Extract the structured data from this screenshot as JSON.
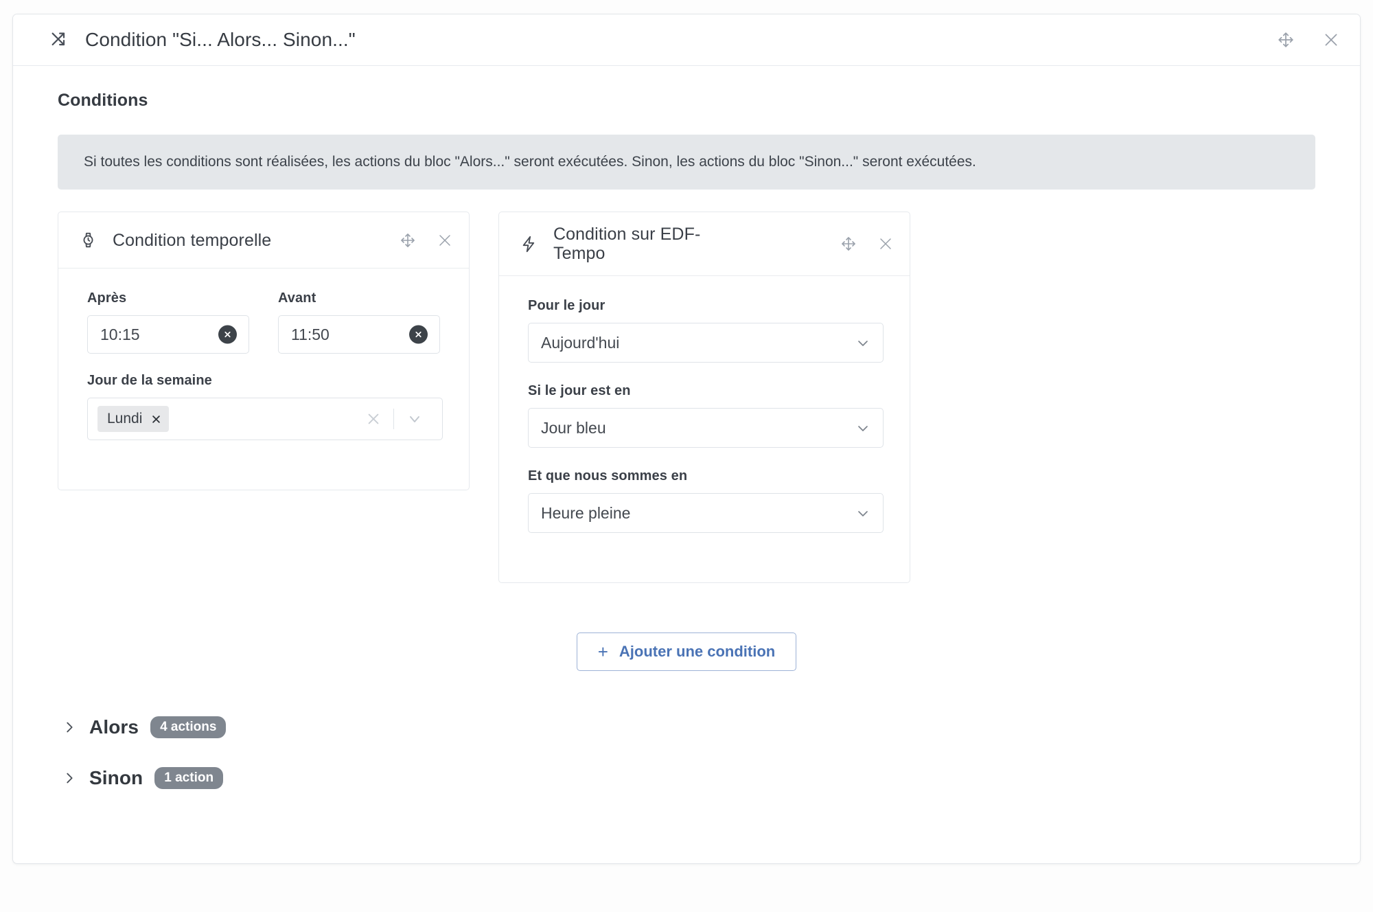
{
  "header": {
    "icon": "shuffle-icon",
    "title": "Condition \"Si... Alors... Sinon...\"",
    "move_icon": "move-icon",
    "close_icon": "close-icon"
  },
  "conditions_section": {
    "title": "Conditions",
    "info_text": "Si toutes les conditions sont réalisées, les actions du bloc \"Alors...\" seront exécutées. Sinon, les actions du bloc \"Sinon...\" seront exécutées.",
    "cards": [
      {
        "icon": "watch-icon",
        "title": "Condition temporelle",
        "fields": {
          "after_label": "Après",
          "after_value": "10:15",
          "before_label": "Avant",
          "before_value": "11:50",
          "weekday_label": "Jour de la semaine",
          "weekday_chip": "Lundi"
        }
      },
      {
        "icon": "lightning-icon",
        "title": "Condition sur EDF-Tempo",
        "fields": {
          "day_label": "Pour le jour",
          "day_value": "Aujourd'hui",
          "color_label": "Si le jour est en",
          "color_value": "Jour bleu",
          "period_label": "Et que nous sommes en",
          "period_value": "Heure pleine"
        }
      }
    ],
    "add_button": {
      "icon": "plus-icon",
      "label": "Ajouter une condition"
    }
  },
  "accordions": [
    {
      "caret": "chevron-right-icon",
      "label": "Alors",
      "badge": "4 actions"
    },
    {
      "caret": "chevron-right-icon",
      "label": "Sinon",
      "badge": "1 action"
    }
  ],
  "colors": {
    "accent_blue": "#4a73b5",
    "badge_gray": "#7f868f",
    "banner_gray": "#e4e7ea",
    "border": "#e3e6ea"
  }
}
